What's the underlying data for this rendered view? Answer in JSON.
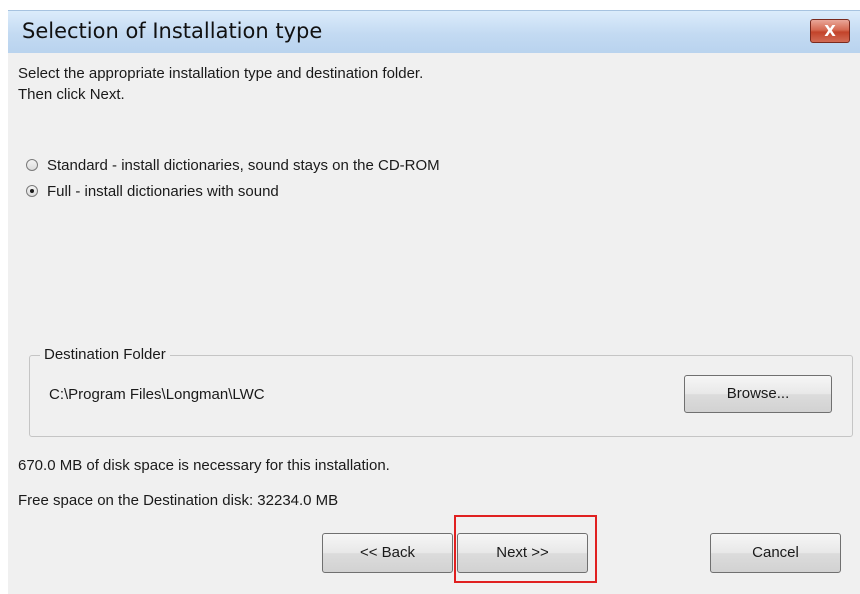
{
  "window": {
    "title": "Selection of Installation type",
    "close_glyph": "X"
  },
  "instructions": {
    "line1": "Select the appropriate installation type and destination folder.",
    "line2": "Then click Next."
  },
  "install_options": [
    {
      "label": "Standard - install dictionaries, sound stays on the CD-ROM",
      "selected": false
    },
    {
      "label": "Full - install dictionaries with sound",
      "selected": true
    }
  ],
  "destination": {
    "legend": "Destination Folder",
    "path": "C:\\Program Files\\Longman\\LWC",
    "browse_label": "Browse..."
  },
  "disk_info": {
    "required": "670.0 MB of disk space is necessary for this installation.",
    "free": "Free space on the Destination disk: 32234.0 MB"
  },
  "buttons": {
    "back": "<< Back",
    "next": "Next >>",
    "cancel": "Cancel"
  },
  "colors": {
    "highlight": "#e02020",
    "close_button": "#c2432a"
  },
  "icons": {
    "close": "close-icon"
  }
}
